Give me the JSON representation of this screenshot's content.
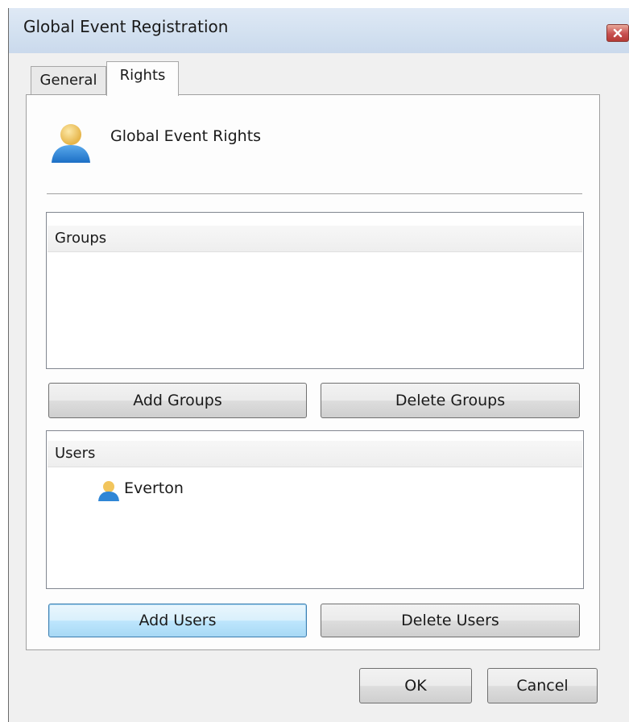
{
  "window": {
    "title": "Global Event Registration"
  },
  "tabs": [
    {
      "label": "General",
      "active": false
    },
    {
      "label": "Rights",
      "active": true
    }
  ],
  "rights": {
    "header_icon": "user-icon",
    "title": "Global Event Rights",
    "groups": {
      "header": "Groups",
      "items": [],
      "add_label": "Add Groups",
      "delete_label": "Delete Groups"
    },
    "users": {
      "header": "Users",
      "items": [
        {
          "name": "Everton",
          "icon": "user-icon"
        }
      ],
      "add_label": "Add Users",
      "delete_label": "Delete Users"
    }
  },
  "footer": {
    "ok_label": "OK",
    "cancel_label": "Cancel"
  }
}
